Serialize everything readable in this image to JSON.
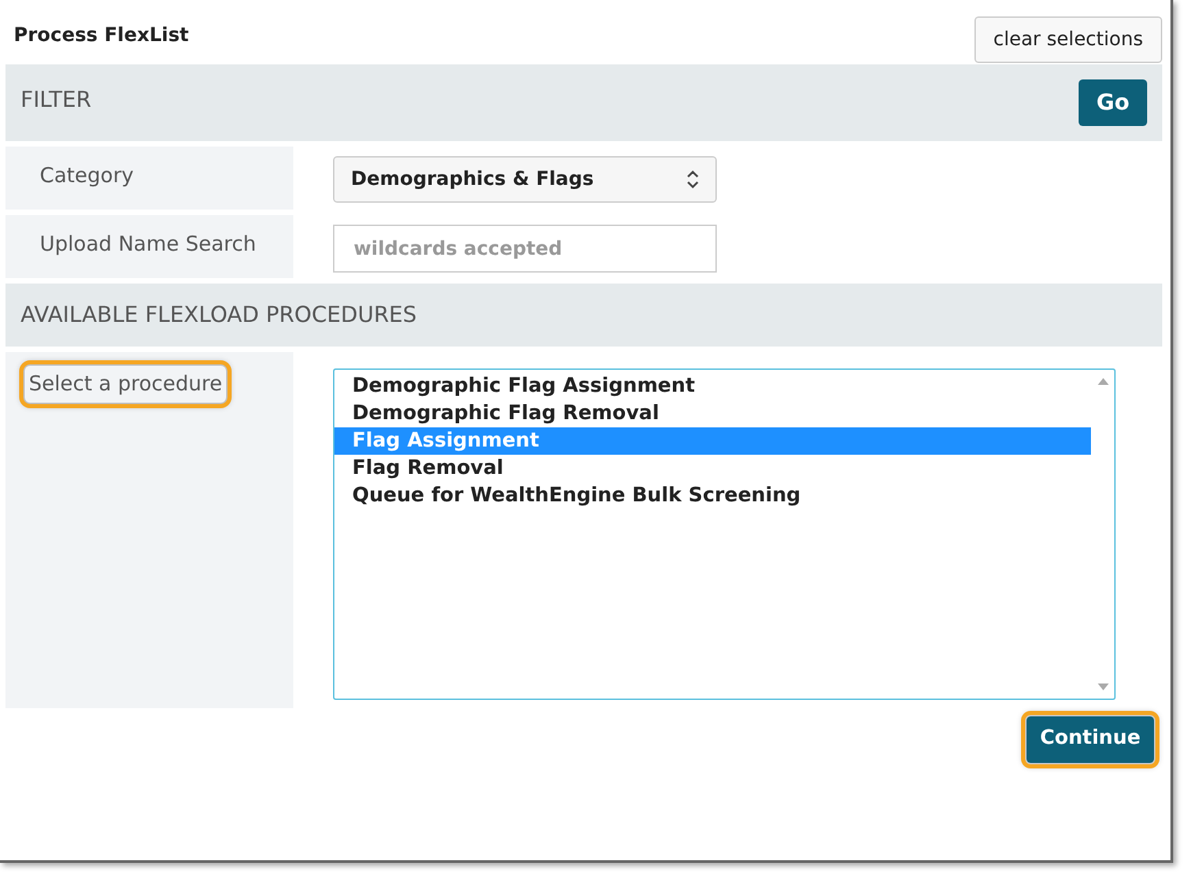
{
  "title": "Process FlexList",
  "clear_button": "clear selections",
  "filter": {
    "heading": "FILTER",
    "go_button": "Go",
    "fields": [
      {
        "kind": "select",
        "label": "Category",
        "value": "Demographics & Flags"
      },
      {
        "kind": "text",
        "label": "Upload Name Search",
        "placeholder": "wildcards accepted"
      }
    ]
  },
  "procedures": {
    "heading": "AVAILABLE FLEXLOAD PROCEDURES",
    "label": "Select a procedure",
    "label_highlighted": true,
    "options": [
      {
        "label": "Demographic Flag Assignment",
        "selected": false
      },
      {
        "label": "Demographic Flag Removal",
        "selected": false
      },
      {
        "label": "Flag Assignment",
        "selected": true
      },
      {
        "label": "Flag Removal",
        "selected": false
      },
      {
        "label": "Queue for WealthEngine Bulk Screening",
        "selected": false
      }
    ],
    "continue_button": "Continue",
    "continue_highlighted": true
  }
}
